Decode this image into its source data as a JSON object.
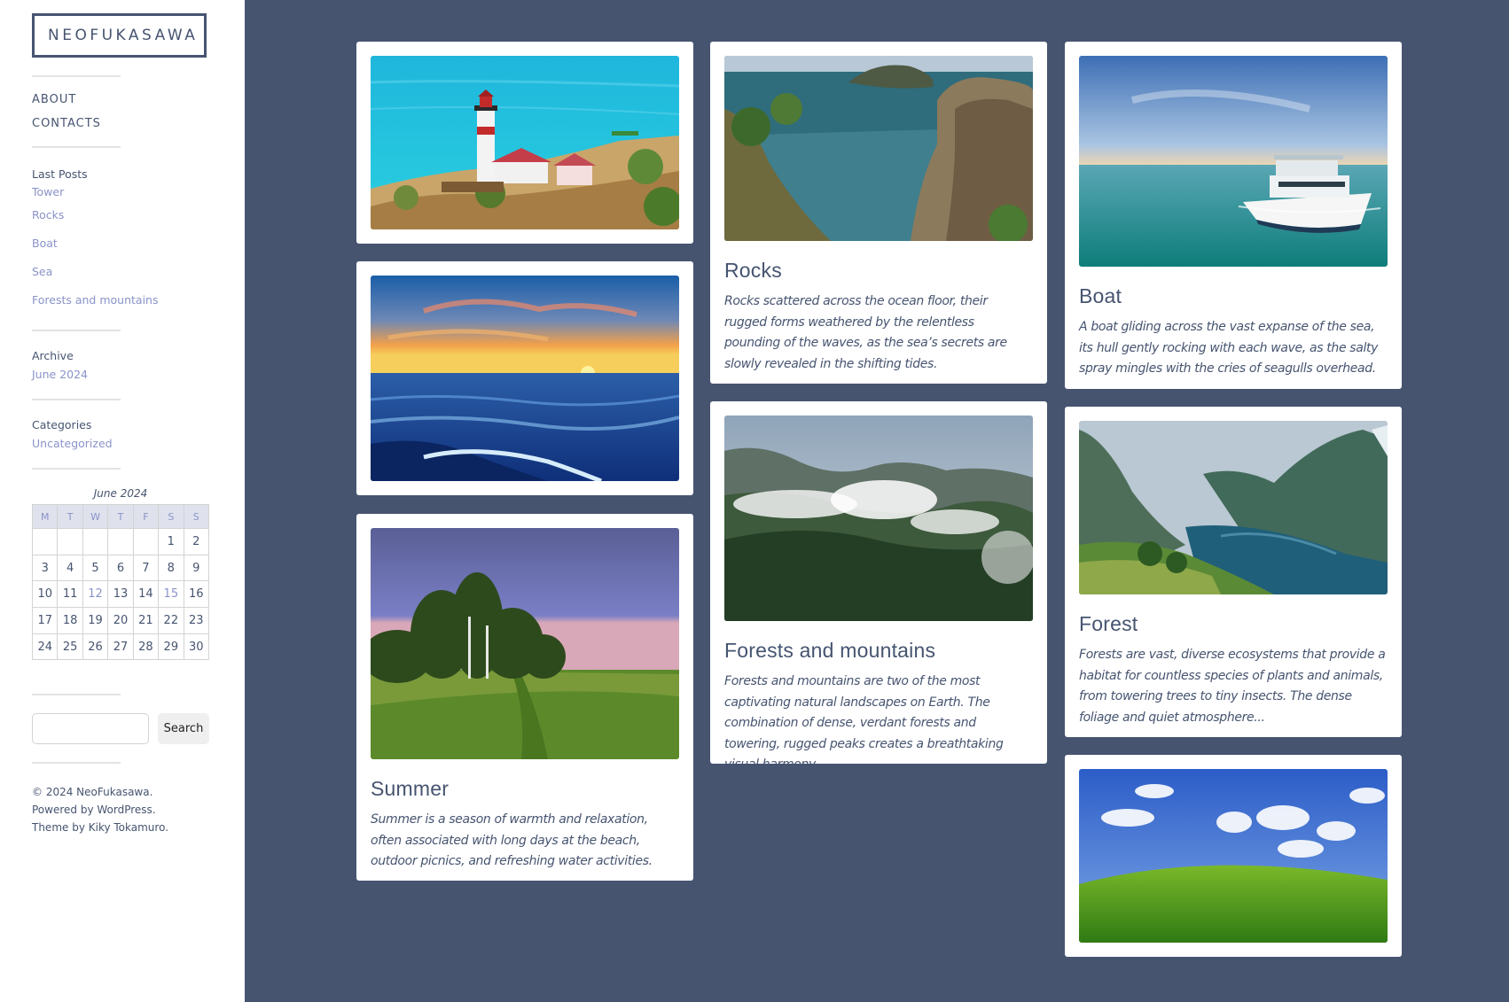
{
  "site": {
    "title": "NEOFUKASAWA"
  },
  "nav": {
    "items": [
      "ABOUT",
      "CONTACTS"
    ]
  },
  "last_posts": {
    "title": "Last Posts",
    "items": [
      "Tower",
      "Rocks",
      "Boat",
      "Sea",
      "Forests and mountains"
    ]
  },
  "archive": {
    "title": "Archive",
    "items": [
      "June 2024"
    ]
  },
  "categories": {
    "title": "Categories",
    "items": [
      "Uncategorized"
    ]
  },
  "calendar": {
    "caption": "June 2024",
    "days": [
      "M",
      "T",
      "W",
      "T",
      "F",
      "S",
      "S"
    ],
    "weeks": [
      [
        "",
        "",
        "",
        "",
        "",
        "1",
        "2"
      ],
      [
        "3",
        "4",
        "5",
        "6",
        "7",
        "8",
        "9"
      ],
      [
        "10",
        "11",
        "12",
        "13",
        "14",
        "15",
        "16"
      ],
      [
        "17",
        "18",
        "19",
        "20",
        "21",
        "22",
        "23"
      ],
      [
        "24",
        "25",
        "26",
        "27",
        "28",
        "29",
        "30"
      ]
    ],
    "linked_days": [
      "12",
      "15"
    ]
  },
  "search": {
    "button_label": "Search",
    "placeholder": ""
  },
  "footer": {
    "lines": [
      "© 2024 NeoFukasawa.",
      "Powered by WordPress.",
      "Theme by Kiky Tokamuro."
    ]
  },
  "posts": {
    "tower": {
      "image": "lighthouse-photo"
    },
    "sea": {
      "image": "sunset-sea-photo"
    },
    "summer": {
      "image": "summer-field-photo",
      "title": "Summer",
      "excerpt": "Summer is a season of warmth and relaxation, often associated with long days at the beach, outdoor picnics, and refreshing water activities."
    },
    "rocks": {
      "image": "rocky-cliffs-photo",
      "title": "Rocks",
      "excerpt": "Rocks scattered across the ocean floor, their rugged forms weathered by the relentless pounding of the waves, as the sea’s secrets are slowly revealed in the shifting tides."
    },
    "forests": {
      "image": "misty-forest-photo",
      "title": "Forests and mountains",
      "excerpt": "Forests and mountains are two of the most captivating natural landscapes on Earth. The combination of dense, verdant forests and towering, rugged peaks creates a breathtaking visual harmony."
    },
    "boat": {
      "image": "boat-sea-photo",
      "title": "Boat",
      "excerpt": "A boat gliding across the vast expanse of the sea, its hull gently rocking with each wave, as the salty spray mingles with the cries of seagulls overhead."
    },
    "forest": {
      "image": "fjord-forest-photo",
      "title": "Forest",
      "excerpt": "Forests are vast, diverse ecosystems that provide a habitat for countless species of plants and animals, from towering trees to tiny insects. The dense foliage and quiet atmosphere..."
    },
    "hill": {
      "image": "green-hill-photo"
    }
  }
}
